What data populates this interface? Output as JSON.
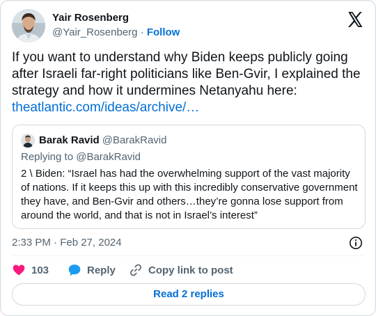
{
  "author": {
    "name": "Yair Rosenberg",
    "handle": "@Yair_Rosenberg",
    "separator": "·",
    "follow_label": "Follow"
  },
  "tweet": {
    "text": "If you want to understand why Biden keeps publicly going after Israeli far-right politicians like Ben-Gvir, I explained the strategy and how it undermines Netanyahu here:",
    "link_text": "theatlantic.com/ideas/archive/…",
    "timestamp": "2:33 PM · Feb 27, 2024"
  },
  "quote": {
    "name": "Barak Ravid",
    "handle": "@BarakRavid",
    "replying_to": "Replying to @BarakRavid",
    "text": "2 \\ Biden: “Israel has had the overwhelming support of the vast majority of nations. If it keeps this up with this incredibly conservative government they have, and Ben-Gvir and others…they’re gonna lose support from around the world, and that is not in Israel’s interest”"
  },
  "actions": {
    "like_count": "103",
    "reply_label": "Reply",
    "copy_label": "Copy link to post",
    "read_replies_label": "Read 2 replies"
  },
  "colors": {
    "like": "#f91880",
    "reply": "#1d9bf0",
    "link": "#006fd6",
    "muted": "#536471"
  },
  "icons": [
    "x-logo-icon",
    "info-icon",
    "heart-icon",
    "speech-bubble-icon",
    "link-chain-icon"
  ]
}
